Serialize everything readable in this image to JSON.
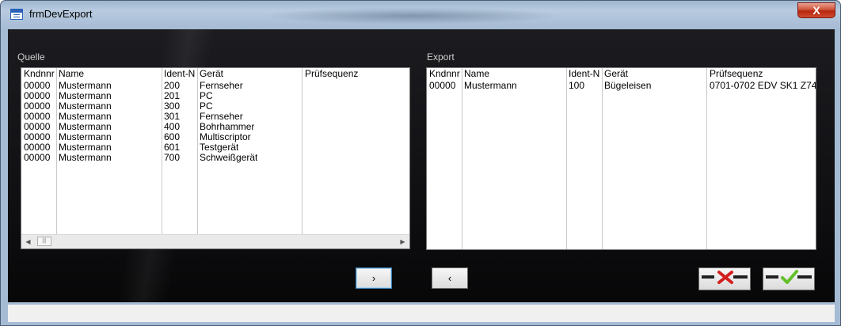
{
  "window": {
    "title": "frmDevExport",
    "close_label": "X"
  },
  "left": {
    "label": "Quelle",
    "columns": [
      "Kndnnr",
      "Name",
      "Ident-N",
      "Gerät",
      "Prüfsequenz"
    ],
    "rows": [
      [
        "00000",
        "Mustermann",
        "200",
        "Fernseher",
        ""
      ],
      [
        "00000",
        "Mustermann",
        "201",
        "PC",
        ""
      ],
      [
        "00000",
        "Mustermann",
        "300",
        "PC",
        ""
      ],
      [
        "00000",
        "Mustermann",
        "301",
        "Fernseher",
        ""
      ],
      [
        "00000",
        "Mustermann",
        "400",
        "Bohrhammer",
        ""
      ],
      [
        "00000",
        "Mustermann",
        "600",
        "Multiscriptor",
        ""
      ],
      [
        "00000",
        "Mustermann",
        "601",
        "Testgerät",
        ""
      ],
      [
        "00000",
        "Mustermann",
        "700",
        "Schweißgerät",
        ""
      ]
    ],
    "scroll_thumb": "|||"
  },
  "right": {
    "label": "Export",
    "columns": [
      "Kndnnr",
      "Name",
      "Ident-N",
      "Gerät",
      "Prüfsequenz"
    ],
    "rows": [
      [
        "00000",
        "Mustermann",
        "100",
        "Bügeleisen",
        "0701-0702 EDV SK1 Z74"
      ]
    ]
  },
  "buttons": {
    "move_right": "›",
    "move_left": "‹"
  },
  "icons": {
    "cancel": "cancel-red-x-icon",
    "confirm": "confirm-green-check-icon"
  },
  "colors": {
    "cancel": "#d21f1f",
    "confirm": "#63c02a"
  }
}
